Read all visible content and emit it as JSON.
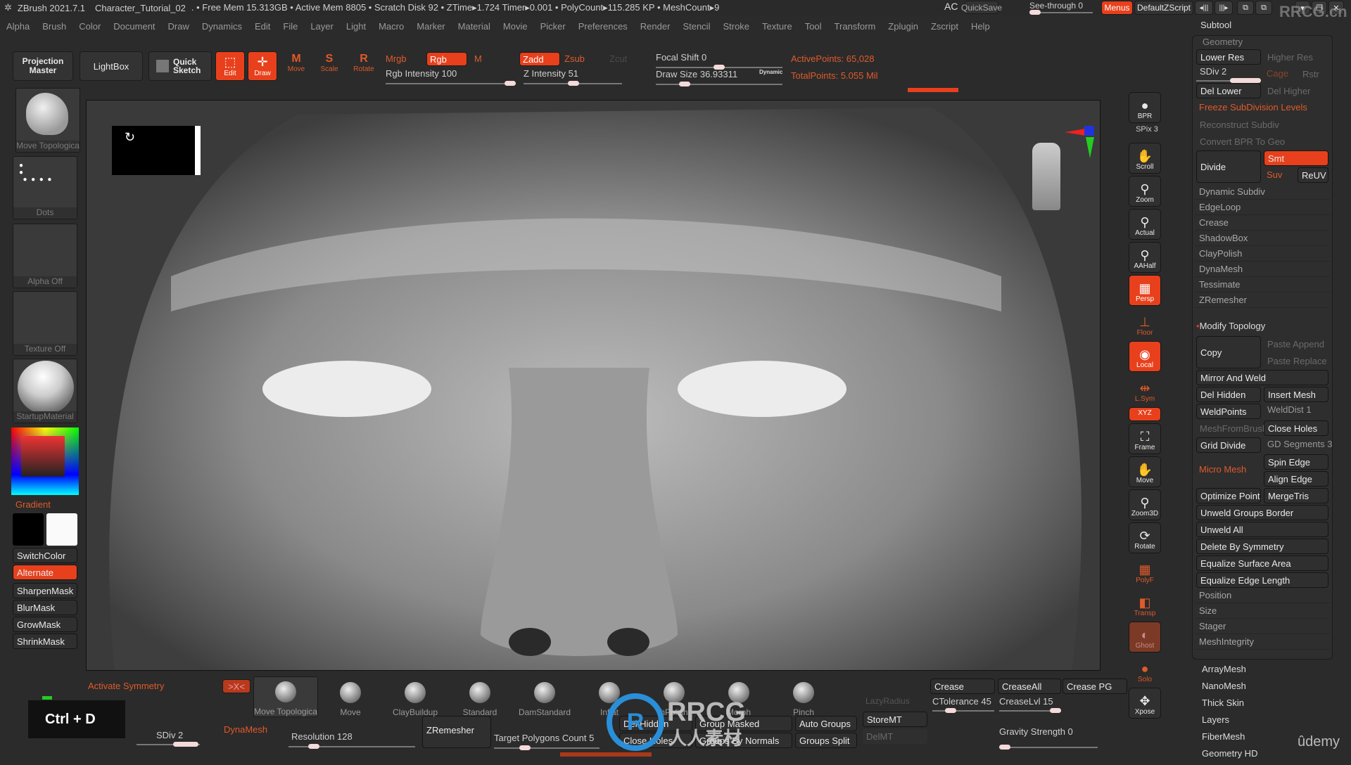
{
  "titlebar": {
    "app": "ZBrush 2021.7.1",
    "document": "Character_Tutorial_02",
    "stats": ". • Free Mem 15.313GB • Active Mem 8805 • Scratch Disk 92 • ZTime▸1.724 Timer▸0.001 • PolyCount▸115.285 KP • MeshCount▸9",
    "ac": "AC",
    "quicksave": "QuickSave",
    "seethrough": "See-through  0",
    "menus": "Menus",
    "defaultzscript": "DefaultZScript",
    "watermark": "RRCG.cn"
  },
  "menubar": [
    "Alpha",
    "Brush",
    "Color",
    "Document",
    "Draw",
    "Dynamics",
    "Edit",
    "File",
    "Layer",
    "Light",
    "Macro",
    "Marker",
    "Material",
    "Movie",
    "Picker",
    "Preferences",
    "Render",
    "Stencil",
    "Stroke",
    "Texture",
    "Tool",
    "Transform",
    "Zplugin",
    "Zscript",
    "Help"
  ],
  "toolbar": {
    "projection_master": "Projection Master",
    "lightbox": "LightBox",
    "quick_sketch": "Quick Sketch",
    "edit": "Edit",
    "draw": "Draw",
    "move": "Move",
    "scale": "Scale",
    "rotate": "Rotate",
    "mrgb": "Mrgb",
    "rgb": "Rgb",
    "m": "M",
    "rgb_intensity": "Rgb Intensity 100",
    "zadd": "Zadd",
    "zsub": "Zsub",
    "zcut": "Zcut",
    "z_intensity": "Z Intensity 51",
    "focal_shift": "Focal Shift 0",
    "draw_size": "Draw Size 36.93311",
    "dynamic": "Dynamic",
    "active_points": "ActivePoints: 65,028",
    "total_points": "TotalPoints: 5.055 Mil"
  },
  "sliders": {
    "rgb_intensity": 1.0,
    "z_intensity": 0.51,
    "focal_shift": 0.5,
    "draw_size": 0.2,
    "see_through": 0.0
  },
  "leftpanel": {
    "brush": "Move Topologica",
    "stroke": "Dots",
    "alpha": "Alpha Off",
    "texture": "Texture Off",
    "material": "StartupMaterial",
    "gradient": "Gradient",
    "switchcolor": "SwitchColor",
    "alternate": "Alternate",
    "masks": [
      "SharpenMask",
      "BlurMask",
      "GrowMask",
      "ShrinkMask"
    ]
  },
  "rightshelf": [
    {
      "label": "BPR",
      "style": "normal",
      "glyph": "●"
    },
    {
      "label": "SPix 3",
      "style": "slider"
    },
    {
      "label": "Scroll",
      "style": "normal",
      "glyph": "✋"
    },
    {
      "label": "Zoom",
      "style": "normal",
      "glyph": "⚲"
    },
    {
      "label": "Actual",
      "style": "normal",
      "glyph": "⚲"
    },
    {
      "label": "AAHalf",
      "style": "normal",
      "glyph": "⚲"
    },
    {
      "label": "Persp",
      "style": "orange",
      "glyph": "▦"
    },
    {
      "label": "Floor",
      "style": "text",
      "glyph": "⊥"
    },
    {
      "label": "Local",
      "style": "orange",
      "glyph": "◉"
    },
    {
      "label": "L.Sym",
      "style": "text",
      "glyph": "⇹"
    },
    {
      "label": "XYZ",
      "style": "orange-small",
      "glyph": "⟲"
    },
    {
      "label": "Frame",
      "style": "normal",
      "glyph": "⛶"
    },
    {
      "label": "Move",
      "style": "normal",
      "glyph": "✋"
    },
    {
      "label": "Zoom3D",
      "style": "normal",
      "glyph": "⚲"
    },
    {
      "label": "Rotate",
      "style": "normal",
      "glyph": "⟳"
    },
    {
      "label": "PolyF",
      "style": "text",
      "glyph": "▦"
    },
    {
      "label": "Transp",
      "style": "text",
      "glyph": "◧"
    },
    {
      "label": "Ghost",
      "style": "ghost",
      "glyph": "◐"
    },
    {
      "label": "Solo",
      "style": "text",
      "glyph": "●"
    },
    {
      "label": "Xpose",
      "style": "normal",
      "glyph": "✥"
    }
  ],
  "rightpanel": {
    "subtool": "Subtool",
    "geometry": "Geometry",
    "lower_res": "Lower Res",
    "higher_res": "Higher Res",
    "sdiv": "SDiv 2",
    "cage": "Cage",
    "rstr": "Rstr",
    "del_lower": "Del Lower",
    "del_higher": "Del Higher",
    "freeze": "Freeze SubDivision Levels",
    "reconstruct": "Reconstruct Subdiv",
    "convert_bpr": "Convert BPR To Geo",
    "divide": "Divide",
    "smt": "Smt",
    "suv": "Suv",
    "reuv": "ReUV",
    "sections": [
      "Dynamic Subdiv",
      "EdgeLoop",
      "Crease",
      "ShadowBox",
      "ClayPolish",
      "DynaMesh",
      "Tessimate",
      "ZRemesher"
    ],
    "modify_topology": "Modify Topology",
    "copy": "Copy",
    "paste_append": "Paste Append",
    "paste_replace": "Paste Replace",
    "mirror_weld": "Mirror And Weld",
    "del_hidden": "Del Hidden",
    "insert_mesh": "Insert Mesh",
    "weldpoints": "WeldPoints",
    "welddist": "WeldDist 1",
    "meshfrombrush": "MeshFromBrush",
    "close_holes": "Close Holes",
    "grid_divide": "Grid Divide",
    "gd_segments": "GD Segments 3",
    "micro_mesh": "Micro Mesh",
    "spin_edge": "Spin Edge",
    "align_edge": "Align Edge",
    "optimize_points": "Optimize Points",
    "mergetris": "MergeTris",
    "wide_buttons": [
      "Unweld Groups Border",
      "Unweld All",
      "Delete By Symmetry",
      "Equalize Surface Area",
      "Equalize Edge Length"
    ],
    "tail_sections": [
      "Position",
      "Size",
      "Stager",
      "MeshIntegrity"
    ],
    "more": [
      "ArrayMesh",
      "NanoMesh",
      "Thick Skin",
      "Layers",
      "FiberMesh",
      "Geometry HD"
    ],
    "udemy": "ûdemy"
  },
  "bottom": {
    "activate_symmetry": "Activate Symmetry",
    "sym_button": ">X<",
    "shortcut": "Ctrl + D",
    "sdiv": "SDiv 2",
    "dynamesh": "DynaMesh",
    "resolution": "Resolution 128",
    "zremesher": "ZRemesher",
    "target_polygons": "Target Polygons Count 5",
    "brushes": [
      "Move Topologica",
      "Move",
      "ClayBuildup",
      "Standard",
      "DamStandard",
      "Inflat",
      "hPolish",
      "Morph",
      "Pinch"
    ],
    "del_hidden": "Del Hidden",
    "close_holes": "Close Holes",
    "group_masked": "Group Masked",
    "groups_by_normals": "Groups By Normals",
    "auto_groups": "Auto Groups",
    "groups_split": "Groups Split",
    "lazyradius": "LazyRadius",
    "storemt": "StoreMT",
    "delmt": "DelMT",
    "crease": "Crease",
    "creaseall": "CreaseAll",
    "crease_pg": "Crease PG",
    "ctolerance": "CTolerance 45",
    "creaselvl": "CreaseLvl 15",
    "gravity": "Gravity Strength 0",
    "watermark_logo": "RRCG",
    "watermark_sub": "人人素材"
  },
  "colors": {
    "accent": "#e8401c",
    "accent_text": "#e05a2a",
    "bg": "#2b2b2b"
  }
}
